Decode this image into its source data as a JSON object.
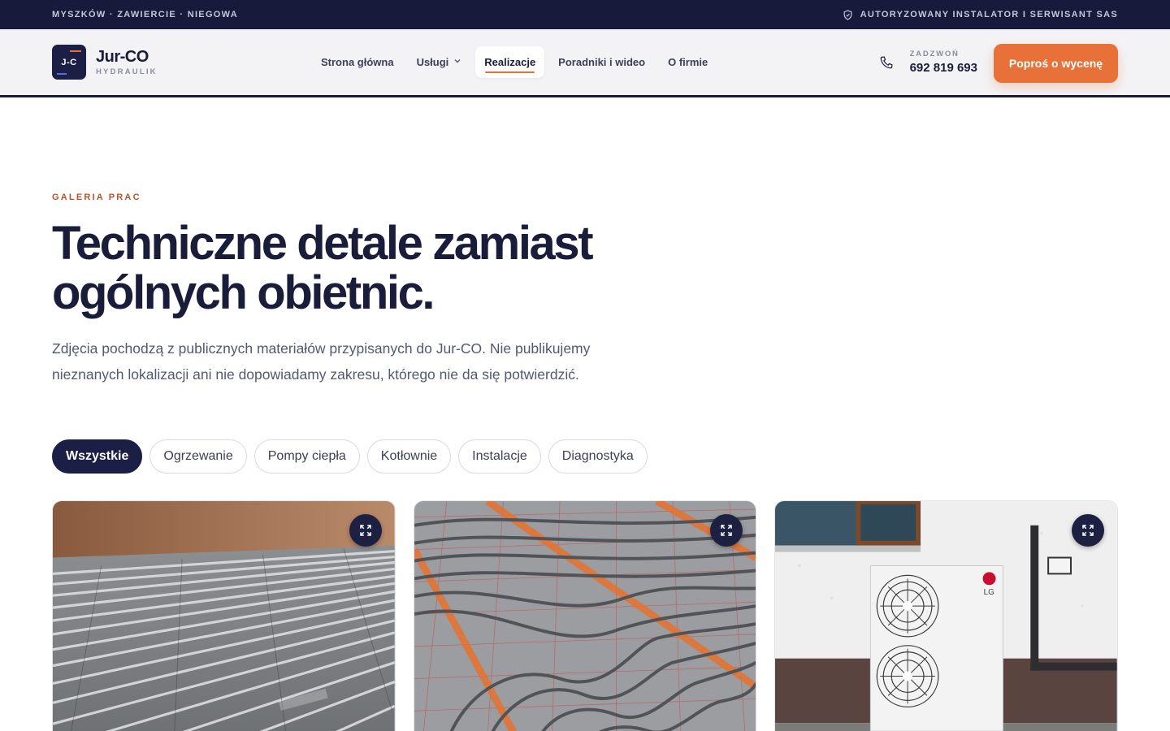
{
  "topbar": {
    "locations": "MYSZKÓW · ZAWIERCIE · NIEGOWA",
    "authorized": "AUTORYZOWANY INSTALATOR I SERWISANT SAS"
  },
  "brand": {
    "mark": "J-C",
    "name": "Jur-CO",
    "subtitle": "HYDRAULIK"
  },
  "nav": {
    "items": [
      {
        "label": "Strona główna"
      },
      {
        "label": "Usługi"
      },
      {
        "label": "Realizacje"
      },
      {
        "label": "Poradniki i wideo"
      },
      {
        "label": "O firmie"
      }
    ],
    "active_index": 2
  },
  "contact": {
    "label": "ZADZWOŃ",
    "phone": "692 819 693"
  },
  "cta": {
    "label": "Poproś o wycenę"
  },
  "hero": {
    "eyebrow": "GALERIA PRAC",
    "headline": "Techniczne detale zamiast ogólnych obietnic.",
    "lead": "Zdjęcia pochodzą z publicznych materiałów przypisanych do Jur-CO. Nie publikujemy nieznanych lokalizacji ani nie dopowiadamy zakresu, którego nie da się potwierdzić."
  },
  "filters": {
    "items": [
      {
        "label": "Wszystkie"
      },
      {
        "label": "Ogrzewanie"
      },
      {
        "label": "Pompy ciepła"
      },
      {
        "label": "Kotłownie"
      },
      {
        "label": "Instalacje"
      },
      {
        "label": "Diagnostyka"
      }
    ],
    "active_index": 0
  },
  "gallery": {
    "cards": [
      {
        "subject": "underfloor-heating-pipes"
      },
      {
        "subject": "underfloor-heating-grid"
      },
      {
        "subject": "heat-pump-outdoor-unit",
        "brand_text": "LG"
      }
    ]
  },
  "colors": {
    "navy": "#171a3b",
    "accent": "#e8713a",
    "eyebrow": "#b4542b",
    "text_muted": "#545870"
  }
}
